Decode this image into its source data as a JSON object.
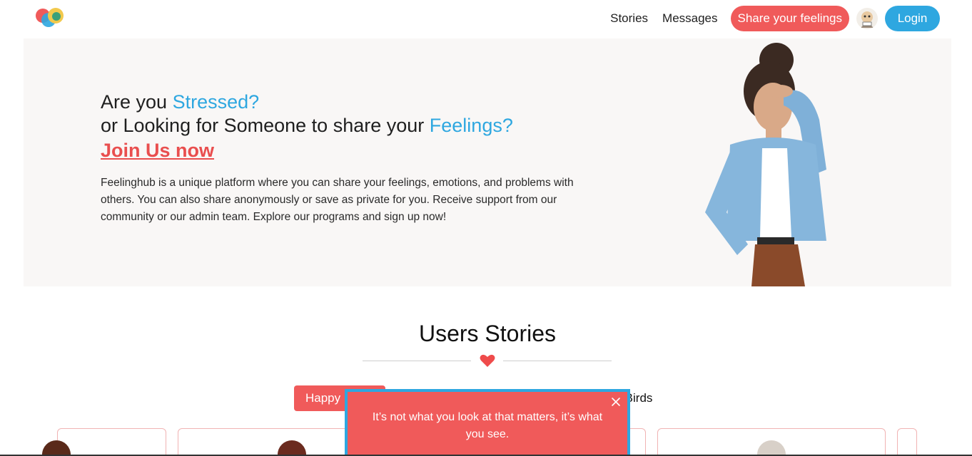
{
  "nav": {
    "logo_icon": "heart-circles-logo-icon",
    "links": [
      "Stories",
      "Messages"
    ],
    "share_label": "Share your feelings",
    "avatar_icon": "avatar-icon",
    "login_label": "Login"
  },
  "hero": {
    "line1_prefix": "Are you ",
    "line1_accent": "Stressed?",
    "line2_prefix": "or Looking for Someone to share your ",
    "line2_accent": "Feelings?",
    "join_label": "Join Us now",
    "description": "Feelinghub is a unique platform where you can share your feelings, emotions, and problems with others. You can also share anonymously or save as private for you. Receive support from our community or our admin team. Explore our programs and sign up now!",
    "figure_icon": "stressed-woman-illustration"
  },
  "stories": {
    "title": "Users Stories",
    "heart_icon": "heart-icon",
    "tab_active_label": "Happy",
    "tab_other_label": "ve Birds"
  },
  "popup": {
    "text": "It’s not what you look at that matters, it’s what you see.",
    "close_icon": "close-icon"
  },
  "colors": {
    "accent_blue": "#2ea7e0",
    "accent_red": "#f05a5a",
    "hero_bg": "#f9f7f6"
  }
}
